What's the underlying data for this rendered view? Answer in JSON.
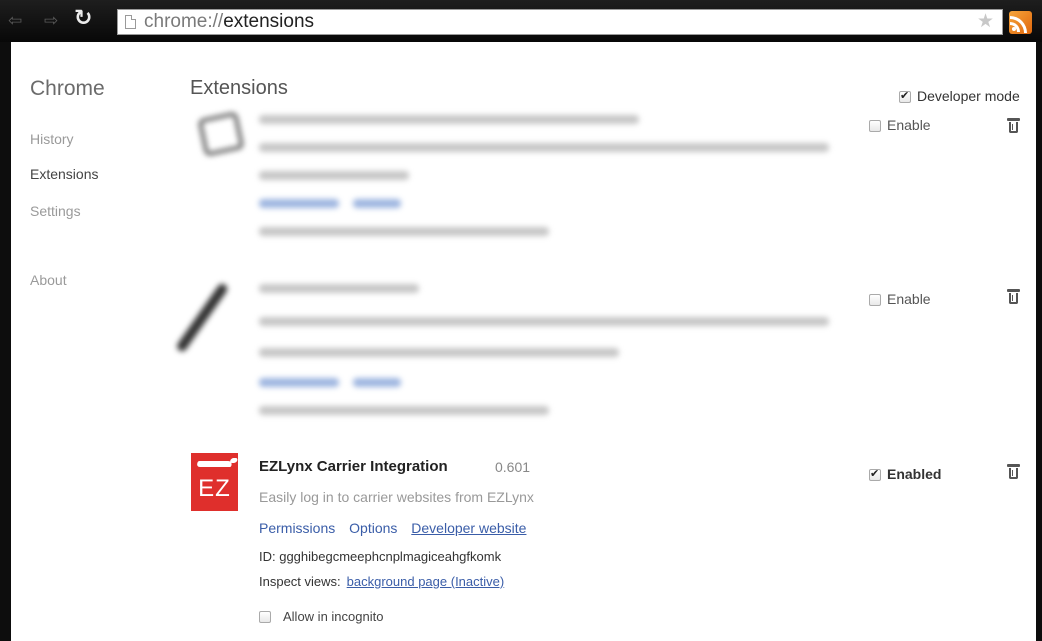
{
  "browser": {
    "url_scheme": "chrome://",
    "url_path": "extensions",
    "icons": [
      "back-arrow-icon",
      "forward-arrow-icon",
      "reload-icon",
      "page-icon",
      "star-icon",
      "rss-icon"
    ]
  },
  "sidebar": {
    "title": "Chrome",
    "items": [
      {
        "label": "History",
        "selected": false
      },
      {
        "label": "Extensions",
        "selected": true
      },
      {
        "label": "Settings",
        "selected": false
      },
      {
        "label": "About",
        "selected": false
      }
    ]
  },
  "main": {
    "title": "Extensions",
    "developer_mode_label": "Developer mode",
    "developer_mode_checked": true
  },
  "extensions": [
    {
      "blurred": true,
      "enable_label": "Enable",
      "enabled": false
    },
    {
      "blurred": true,
      "enable_label": "Enable",
      "enabled": false
    },
    {
      "blurred": false,
      "logo_text": "EZ",
      "name": "EZLynx Carrier Integration",
      "version": "0.601",
      "description": "Easily log in to carrier websites from EZLynx",
      "links": [
        "Permissions",
        "Options",
        "Developer website"
      ],
      "id_text": "ID: ggghibegcmeephcnplmagiceahgfkomk",
      "inspect_label": "Inspect views:",
      "inspect_link": "background page (Inactive)",
      "enabled_label": "Enabled",
      "enabled": true,
      "incognito_label": "Allow in incognito",
      "incognito_checked": false
    }
  ],
  "colors": {
    "link": "#3a5da8",
    "ez_red": "#df2f2c",
    "rss_orange": "#f08a24"
  }
}
